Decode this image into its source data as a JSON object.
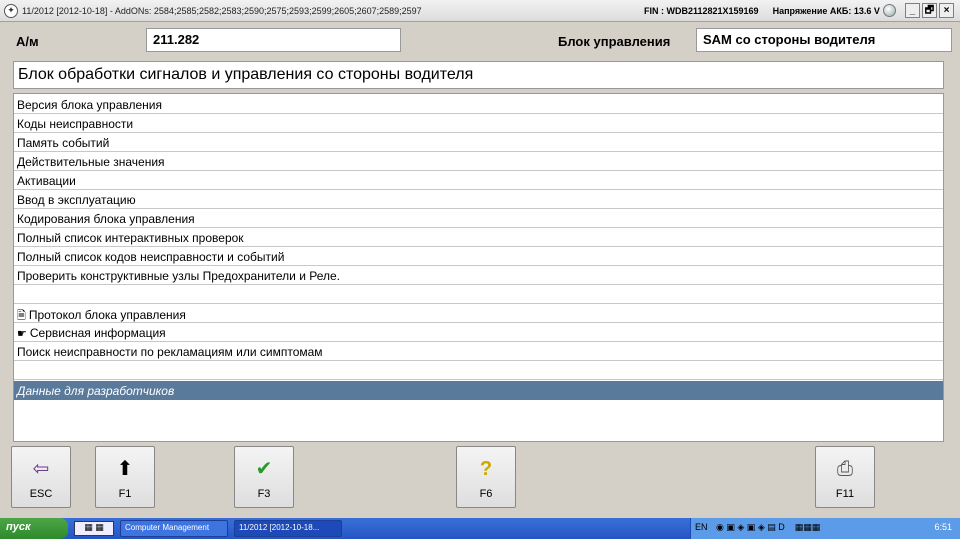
{
  "titlebar": {
    "title": "11/2012 [2012-10-18] - AddONs: 2584;2585;2582;2583;2590;2575;2593;2599;2605;2607;2589;2597",
    "fin": "FIN : WDB2112821X159169",
    "voltage": "Напряжение АКБ: 13.6 V",
    "min_icon": "_",
    "restore_icon": "🗗",
    "close_icon": "×"
  },
  "header": {
    "am_label": "А/м",
    "am_value": "211.282",
    "ecu_label": "Блок управления",
    "ecu_value": "SAM со стороны водителя"
  },
  "panel": {
    "title": "Блок обработки сигналов и управления со стороны водителя"
  },
  "menu": {
    "items": [
      {
        "label": "Версия блока управления"
      },
      {
        "label": "Коды неисправности"
      },
      {
        "label": "Память событий"
      },
      {
        "label": "Действительные значения"
      },
      {
        "label": "Активации"
      },
      {
        "label": "Ввод в эксплуатацию"
      },
      {
        "label": "Кодирования блока управления"
      },
      {
        "label": "Полный список интерактивных проверок"
      },
      {
        "label": "Полный список кодов неисправности и событий"
      },
      {
        "label": "Проверить конструктивные узлы Предохранители и Реле."
      }
    ],
    "protocol": "Протокол блока управления",
    "service": "Сервисная информация",
    "search": "Поиск неисправности по рекламациям или симптомам",
    "developer": "Данные для разработчиков"
  },
  "fkeys": {
    "esc": "ESC",
    "f1": "F1",
    "f3": "F3",
    "f6": "F6",
    "f11": "F11"
  },
  "taskbar": {
    "start": "пуск",
    "task1": "Computer Management",
    "task2": "11/2012 [2012-10-18...",
    "lang": "EN",
    "clock": "6:51"
  },
  "colors": {
    "selected_row": "#5a7a9c",
    "window_bg": "#d4d0c8",
    "taskbar": "#2456c4"
  }
}
